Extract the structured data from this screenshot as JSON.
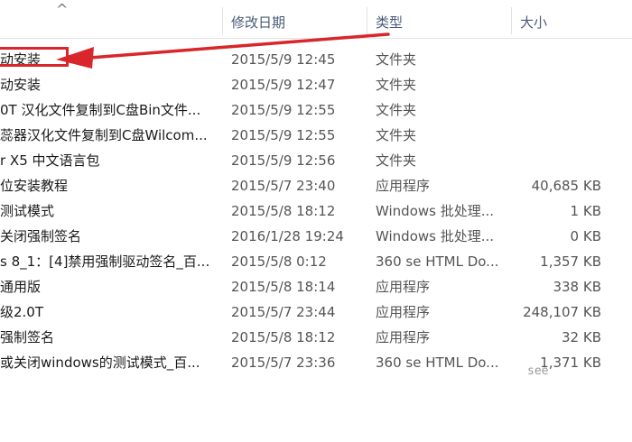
{
  "header": {
    "sort_icon": "^",
    "columns": {
      "date": "修改日期",
      "type": "类型",
      "size": "大小"
    }
  },
  "rows": [
    {
      "name": "动安装",
      "date": "2015/5/9 12:45",
      "type": "文件夹",
      "size": ""
    },
    {
      "name": "动安装",
      "date": "2015/5/9 12:47",
      "type": "文件夹",
      "size": ""
    },
    {
      "name": "0T 汉化文件复制到C盘Bin文件...",
      "date": "2015/5/9 12:55",
      "type": "文件夹",
      "size": ""
    },
    {
      "name": "蕊器汉化文件复制到C盘Wilcom...",
      "date": "2015/5/9 12:55",
      "type": "文件夹",
      "size": ""
    },
    {
      "name": "r X5 中文语言包",
      "date": "2015/5/9 12:56",
      "type": "文件夹",
      "size": ""
    },
    {
      "name": "位安装教程",
      "date": "2015/5/7 23:40",
      "type": "应用程序",
      "size": "40,685 KB"
    },
    {
      "name": "测试模式",
      "date": "2015/5/8 18:12",
      "type": "Windows 批处理...",
      "size": "1 KB"
    },
    {
      "name": "关闭强制签名",
      "date": "2016/1/28 19:24",
      "type": "Windows 批处理...",
      "size": "0 KB"
    },
    {
      "name": "s 8_1：[4]禁用强制驱动签名_百...",
      "date": "2015/5/8 0:12",
      "type": "360 se HTML Do...",
      "size": "1,357 KB"
    },
    {
      "name": "通用版",
      "date": "2015/5/8 18:14",
      "type": "应用程序",
      "size": "338 KB"
    },
    {
      "name": "级2.0T",
      "date": "2015/5/7 23:44",
      "type": "应用程序",
      "size": "248,107 KB"
    },
    {
      "name": "强制签名",
      "date": "2015/5/8 18:12",
      "type": "应用程序",
      "size": "32 KB"
    },
    {
      "name": "或关闭windows的测试模式_百...",
      "date": "2015/5/7 23:36",
      "type": "360 se HTML Do...",
      "size": "1,371 KB"
    }
  ],
  "annotation": {
    "box_color": "#d8262b",
    "arrow_color": "#d8262b"
  },
  "watermark": "see"
}
